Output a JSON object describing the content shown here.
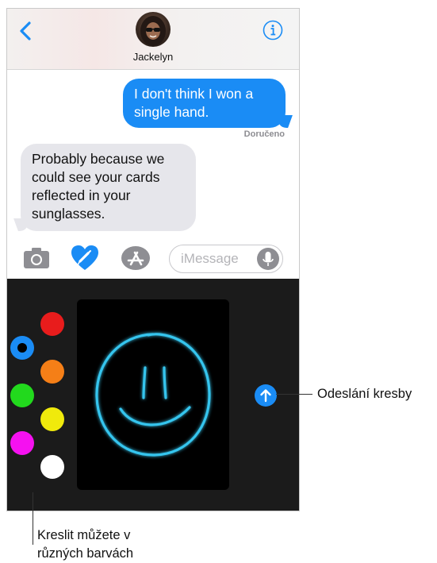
{
  "header": {
    "back_icon": "chevron-left-icon",
    "contact_name": "Jackelyn",
    "info_icon": "info-icon",
    "accent_color": "#1a8cf5"
  },
  "messages": {
    "sent": "I don't think I won a single hand.",
    "status": "Doručeno",
    "received": "Probably because we could see your cards reflected in your sunglasses."
  },
  "toolbar": {
    "camera_icon": "camera-icon",
    "digital_touch_icon": "digital-touch-heart-icon",
    "app_store_icon": "app-store-icon",
    "message_placeholder": "iMessage",
    "mic_icon": "microphone-icon"
  },
  "drawing": {
    "colors": [
      "#1a8cf5",
      "#e81c1c",
      "#f57f17",
      "#22d91d",
      "#f0ea0c",
      "#f511f0",
      "#ffffff"
    ],
    "selected_color": "#1a8cf5",
    "stroke_color": "#35c5ee",
    "send_icon": "arrow-up-icon"
  },
  "callouts": {
    "send_label": "Odeslání kresby",
    "colors_label_line1": "Kreslit můžete v",
    "colors_label_line2": "různých barvách"
  }
}
